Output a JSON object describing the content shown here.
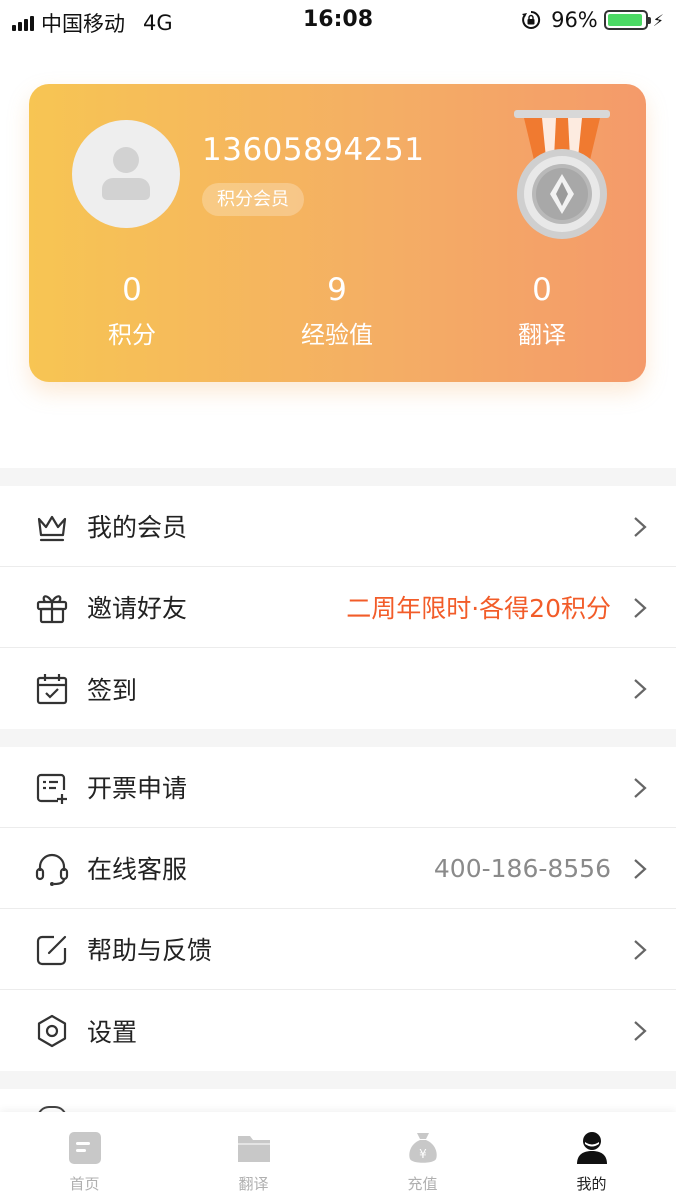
{
  "status_bar": {
    "carrier": "中国移动",
    "network": "4G",
    "time": "16:08",
    "battery": "96%",
    "battery_level": 0.96
  },
  "profile": {
    "phone": "13605894251",
    "member_badge": "积分会员",
    "stats": [
      {
        "value": "0",
        "label": "积分"
      },
      {
        "value": "9",
        "label": "经验值"
      },
      {
        "value": "0",
        "label": "翻译"
      }
    ]
  },
  "menu": {
    "group1": [
      {
        "icon": "crown-icon",
        "label": "我的会员",
        "value": ""
      },
      {
        "icon": "gift-icon",
        "label": "邀请好友",
        "value": "二周年限时·各得20积分"
      },
      {
        "icon": "calendar-check-icon",
        "label": "签到",
        "value": ""
      }
    ],
    "group2": [
      {
        "icon": "invoice-icon",
        "label": "开票申请",
        "value": ""
      },
      {
        "icon": "headset-icon",
        "label": "在线客服",
        "value": "400-186-8556"
      },
      {
        "icon": "edit-icon",
        "label": "帮助与反馈",
        "value": ""
      },
      {
        "icon": "settings-icon",
        "label": "设置",
        "value": ""
      }
    ]
  },
  "tabs": [
    {
      "icon": "home-icon",
      "label": "首页"
    },
    {
      "icon": "folder-icon",
      "label": "翻译"
    },
    {
      "icon": "money-bag-icon",
      "label": "充值"
    },
    {
      "icon": "user-icon",
      "label": "我的"
    }
  ],
  "colors": {
    "accent": "#f25c29",
    "card_gradient_start": "#f7c553",
    "card_gradient_end": "#f49a6a",
    "battery": "#4cd964"
  }
}
